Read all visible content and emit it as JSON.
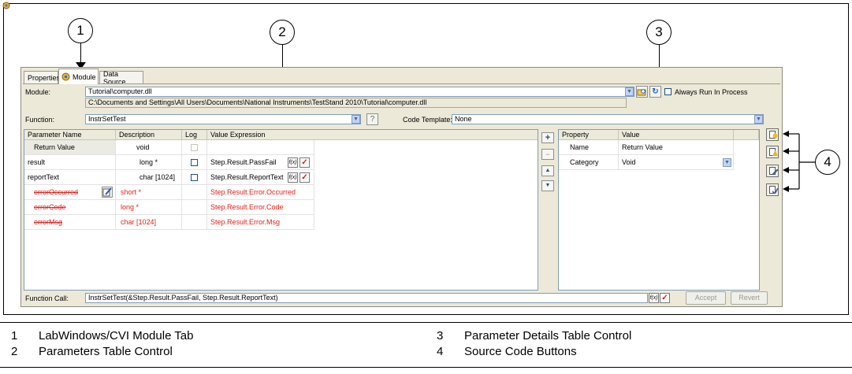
{
  "callouts": [
    "1",
    "2",
    "3",
    "4"
  ],
  "tabs": [
    {
      "label": "Properties"
    },
    {
      "label": "Module",
      "active": true
    },
    {
      "label": "Data Source"
    }
  ],
  "module": {
    "label": "Module:",
    "value": "Tutorial\\computer.dll",
    "path": "C:\\Documents and Settings\\All Users\\Documents\\National Instruments\\TestStand 2010\\Tutorial\\computer.dll",
    "always_run_label": "Always Run In Process"
  },
  "function": {
    "label": "Function:",
    "value": "InstrSetTest",
    "code_template_label": "Code Template:",
    "code_template_value": "None"
  },
  "params_table": {
    "headers": [
      "Parameter Name",
      "Description",
      "Log",
      "Value Expression"
    ],
    "rows": [
      {
        "name": "Return Value",
        "desc": "void",
        "value": ""
      },
      {
        "name": "result",
        "desc": "long *",
        "value": "Step.Result.PassFail"
      },
      {
        "name": "reportText",
        "desc": "char [1024]",
        "value": "Step.Result.ReportText"
      },
      {
        "name": "errorOccurred",
        "desc": "short *",
        "value": "Step.Result.Error.Occurred"
      },
      {
        "name": "errorCode",
        "desc": "long *",
        "value": "Step.Result.Error.Code"
      },
      {
        "name": "errorMsg",
        "desc": "char [1024]",
        "value": "Step.Result.Error.Msg"
      }
    ]
  },
  "details_table": {
    "headers": [
      "Property",
      "Value"
    ],
    "rows": [
      {
        "property": "Name",
        "value": "Return Value"
      },
      {
        "property": "Category",
        "value": "Void"
      }
    ]
  },
  "function_call": {
    "label": "Function Call:",
    "value": "InstrSetTest(&Step.Result.PassFail, Step.Result.ReportText)",
    "accept_label": "Accept",
    "revert_label": "Revert"
  },
  "side_buttons": {
    "add": "+",
    "remove": "−",
    "up": "▲",
    "down": "▼"
  },
  "icons": {
    "fx": "f(x)",
    "check": "✓",
    "dropdown": "▼",
    "help": "?",
    "refresh": "↻"
  },
  "legend": [
    {
      "num": "1",
      "text": "LabWindows/CVI Module Tab"
    },
    {
      "num": "2",
      "text": "Parameters Table Control"
    },
    {
      "num": "3",
      "text": "Parameter Details Table Control"
    },
    {
      "num": "4",
      "text": "Source Code Buttons"
    }
  ]
}
